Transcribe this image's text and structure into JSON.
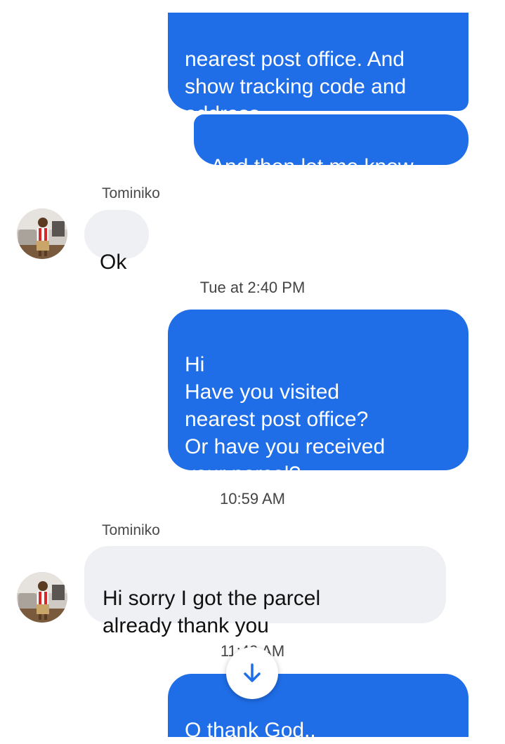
{
  "messages": {
    "m1": "nearest post office. And\nshow tracking code and\naddress.",
    "m2": "And then let me know",
    "m3_sender": "Tominiko",
    "m3": "Ok",
    "ts1": "Tue at 2:40 PM",
    "m4": "Hi\nHave you visited\nnearest post office?\nOr have you received\nyour parcel?",
    "ts2": "10:59 AM",
    "m5_sender": "Tominiko",
    "m5": "Hi sorry I got the parcel\nalready thank you",
    "ts3": "11:42 AM",
    "m6": "O thank God.."
  },
  "icons": {
    "scroll_down": "arrow-down-icon",
    "avatar": "contact-avatar"
  },
  "colors": {
    "outgoing_bubble": "#1f6ee8",
    "incoming_bubble": "#eef0f4",
    "scroll_arrow": "#1f6ee8"
  }
}
